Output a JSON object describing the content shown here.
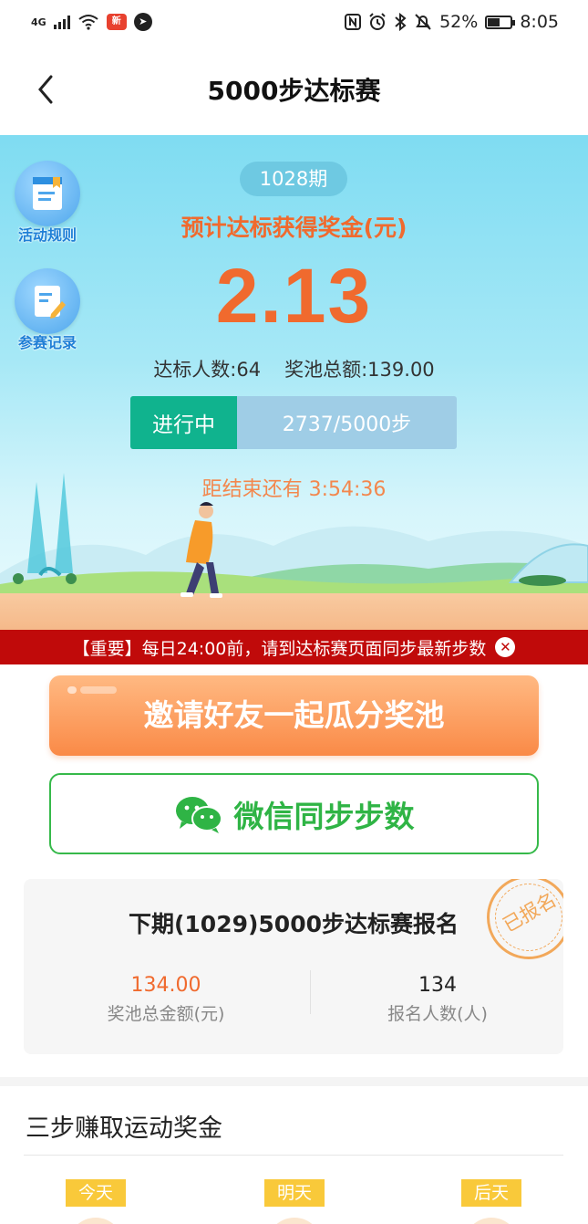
{
  "status_bar": {
    "network": "4G",
    "news_badge": "新",
    "battery": "52%",
    "time": "8:05"
  },
  "header": {
    "title": "5000步达标赛"
  },
  "hero": {
    "side_buttons": [
      {
        "label": "活动规则",
        "icon": "rulebook-icon"
      },
      {
        "label": "参赛记录",
        "icon": "record-icon"
      }
    ],
    "period": "1028期",
    "expect_label": "预计达标获得奖金(元)",
    "amount": "2.13",
    "qualified_count": "达标人数:64",
    "pool_total": "奖池总额:139.00",
    "status": "进行中",
    "steps_progress": "2737/5000步",
    "countdown": "距结束还有 3:54:36"
  },
  "notice": {
    "text": "【重要】每日24:00前，请到达标赛页面同步最新步数",
    "close_symbol": "✕"
  },
  "actions": {
    "invite_label": "邀请好友一起瓜分奖池",
    "wechat_sync_label": "微信同步步数"
  },
  "next_period": {
    "title": "下期(1029)5000步达标赛报名",
    "pool_amount": "134.00",
    "pool_caption": "奖池总金额(元)",
    "signup_count": "134",
    "signup_caption": "报名人数(人)",
    "stamp": "已报名"
  },
  "steps_section": {
    "title": "三步赚取运动奖金",
    "days": [
      "今天",
      "明天",
      "后天"
    ]
  },
  "colors": {
    "accent_orange": "#f06a2e",
    "progress_green": "#10b38e",
    "notice_red": "#c00a0a",
    "wechat_green": "#2fb445",
    "day_tag_yellow": "#f9c93a"
  }
}
